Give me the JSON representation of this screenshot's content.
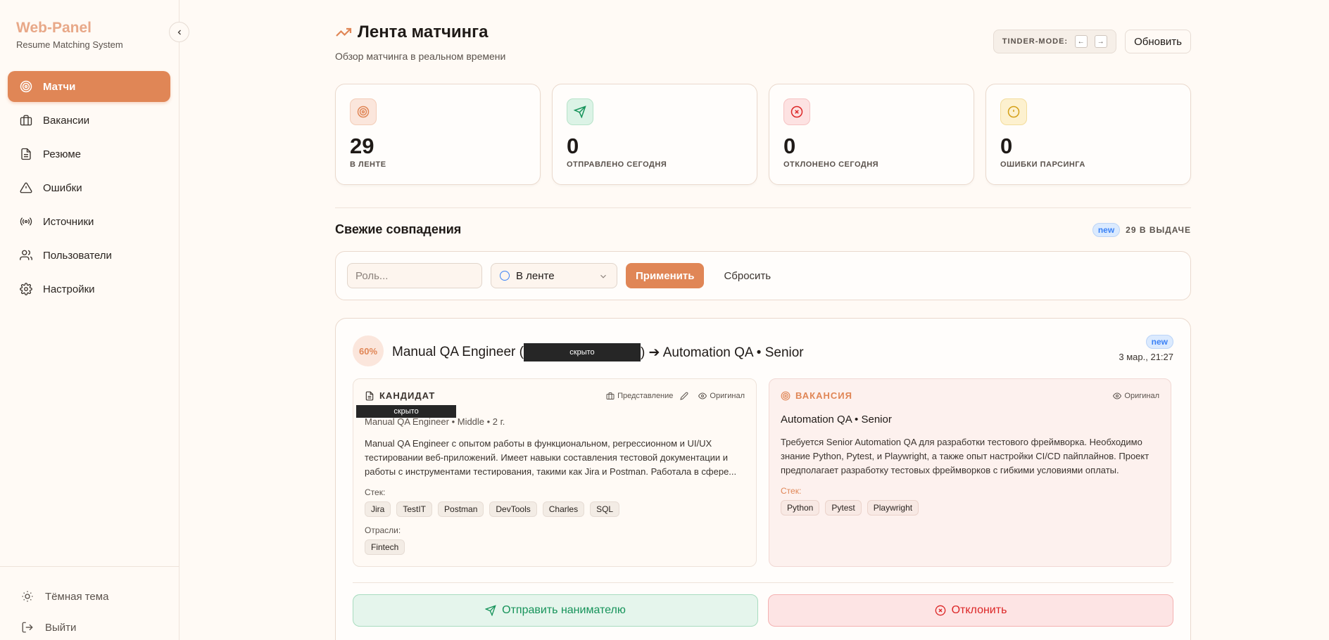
{
  "app": {
    "name": "Web-Panel",
    "subtitle": "Resume Matching System"
  },
  "sidebar": {
    "items": [
      {
        "label": "Матчи",
        "icon": "target-icon",
        "active": true
      },
      {
        "label": "Вакансии",
        "icon": "briefcase-icon"
      },
      {
        "label": "Резюме",
        "icon": "document-icon"
      },
      {
        "label": "Ошибки",
        "icon": "warning-icon"
      },
      {
        "label": "Источники",
        "icon": "broadcast-icon"
      },
      {
        "label": "Пользователи",
        "icon": "users-icon"
      },
      {
        "label": "Настройки",
        "icon": "gear-icon"
      }
    ],
    "bottom": {
      "theme_label": "Тёмная тема",
      "logout_label": "Выйти"
    }
  },
  "header": {
    "title": "Лента матчинга",
    "subtitle": "Обзор матчинга в реальном времени",
    "tinder_mode_label": "TINDER-MODE:",
    "key_left": "←",
    "key_right": "→",
    "refresh_label": "Обновить"
  },
  "stats": [
    {
      "value": "29",
      "label": "В ЛЕНТЕ",
      "color": "#e08656"
    },
    {
      "value": "0",
      "label": "ОТПРАВЛЕНО СЕГОДНЯ",
      "color": "#16935a"
    },
    {
      "value": "0",
      "label": "ОТКЛОНЕНО СЕГОДНЯ",
      "color": "#dc2626"
    },
    {
      "value": "0",
      "label": "ОШИБКИ ПАРСИНГА",
      "color": "#d4a017"
    }
  ],
  "section": {
    "title": "Свежие совпадения",
    "badge": "new",
    "count_label": "29 В ВЫДАЧЕ"
  },
  "filters": {
    "role_placeholder": "Роль...",
    "status_value": "В ленте",
    "apply_label": "Применить",
    "reset_label": "Сбросить"
  },
  "match": {
    "score": "60%",
    "title_prefix": "Manual QA Engineer (",
    "redacted": "скрыто",
    "title_suffix": ") ➔ Automation QA • Senior",
    "badge": "new",
    "date": "3 мар., 21:27",
    "candidate": {
      "heading": "КАНДИДАТ",
      "view_label": "Представление",
      "original_label": "Оригинал",
      "redacted": "скрыто",
      "meta": "Manual QA Engineer • Middle • 2 г.",
      "description": "Manual QA Engineer с опытом работы в функциональном, регрессионном и UI/UX тестировании веб-приложений. Имеет навыки составления тестовой документации и работы с инструментами тестирования, такими как Jira и Postman. Работала в сфере...",
      "stack_label": "Стек:",
      "stack": [
        "Jira",
        "TestIT",
        "Postman",
        "DevTools",
        "Charles",
        "SQL"
      ],
      "industries_label": "Отрасли:",
      "industries": [
        "Fintech"
      ]
    },
    "vacancy": {
      "heading": "ВАКАНСИЯ",
      "original_label": "Оригинал",
      "title": "Automation QA • Senior",
      "description": "Требуется Senior Automation QA для разработки тестового фреймворка. Необходимо знание Python, Pytest, и Playwright, а также опыт настройки CI/CD пайплайнов. Проект предполагает разработку тестовых фреймворков с гибкими условиями оплаты.",
      "stack_label": "Стек:",
      "stack": [
        "Python",
        "Pytest",
        "Playwright"
      ]
    },
    "send_label": "Отправить нанимателю",
    "reject_label": "Отклонить"
  }
}
